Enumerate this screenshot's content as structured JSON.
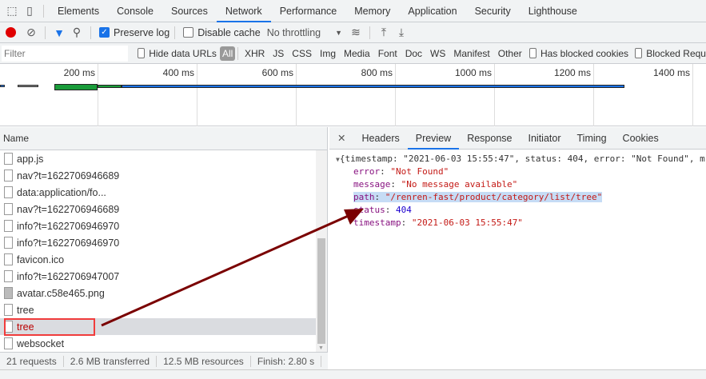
{
  "tabs": [
    "Elements",
    "Console",
    "Sources",
    "Network",
    "Performance",
    "Memory",
    "Application",
    "Security",
    "Lighthouse"
  ],
  "active_tab": "Network",
  "toolbar": {
    "preserve_log": "Preserve log",
    "preserve_log_checked": true,
    "disable_cache": "Disable cache",
    "disable_cache_checked": false,
    "throttling": "No throttling"
  },
  "filterbar": {
    "placeholder": "Filter",
    "hide_data_urls": "Hide data URLs",
    "types": [
      "All",
      "XHR",
      "JS",
      "CSS",
      "Img",
      "Media",
      "Font",
      "Doc",
      "WS",
      "Manifest",
      "Other"
    ],
    "has_blocked_cookies": "Has blocked cookies",
    "blocked_requests": "Blocked Requ"
  },
  "timeline": {
    "ticks": [
      "200 ms",
      "400 ms",
      "600 ms",
      "800 ms",
      "1000 ms",
      "1200 ms",
      "1400 ms"
    ]
  },
  "requests": {
    "header": "Name",
    "rows": [
      {
        "name": "app.js",
        "icon": "file"
      },
      {
        "name": "nav?t=1622706946689",
        "icon": "file"
      },
      {
        "name": "data:application/fo...",
        "icon": "file"
      },
      {
        "name": "nav?t=1622706946689",
        "icon": "file"
      },
      {
        "name": "info?t=1622706946970",
        "icon": "file"
      },
      {
        "name": "info?t=1622706946970",
        "icon": "file"
      },
      {
        "name": "favicon.ico",
        "icon": "file"
      },
      {
        "name": "info?t=1622706947007",
        "icon": "file"
      },
      {
        "name": "avatar.c58e465.png",
        "icon": "image"
      },
      {
        "name": "tree",
        "icon": "file"
      },
      {
        "name": "tree",
        "icon": "file",
        "selected": true
      },
      {
        "name": "websocket",
        "icon": "file"
      }
    ]
  },
  "status": {
    "requests": "21 requests",
    "transferred": "2.6 MB transferred",
    "resources": "12.5 MB resources",
    "finish": "Finish: 2.80 s"
  },
  "detail": {
    "tabs": [
      "Headers",
      "Preview",
      "Response",
      "Initiator",
      "Timing",
      "Cookies"
    ],
    "active": "Preview",
    "summary": "{timestamp: \"2021-06-03 15:55:47\", status: 404, error: \"Not Found\", m",
    "fields": [
      {
        "key": "error",
        "value": "\"Not Found\"",
        "type": "s"
      },
      {
        "key": "message",
        "value": "\"No message available\"",
        "type": "s"
      },
      {
        "key": "path",
        "value": "\"/renren-fast/product/category/list/tree\"",
        "type": "s",
        "highlighted": true
      },
      {
        "key": "status",
        "value": "404",
        "type": "n"
      },
      {
        "key": "timestamp",
        "value": "\"2021-06-03 15:55:47\"",
        "type": "s"
      }
    ]
  },
  "colors": {
    "accent": "#1a73e8",
    "record": "#e00000",
    "annotation": "#f03c3c",
    "arrow": "#7a0000"
  }
}
